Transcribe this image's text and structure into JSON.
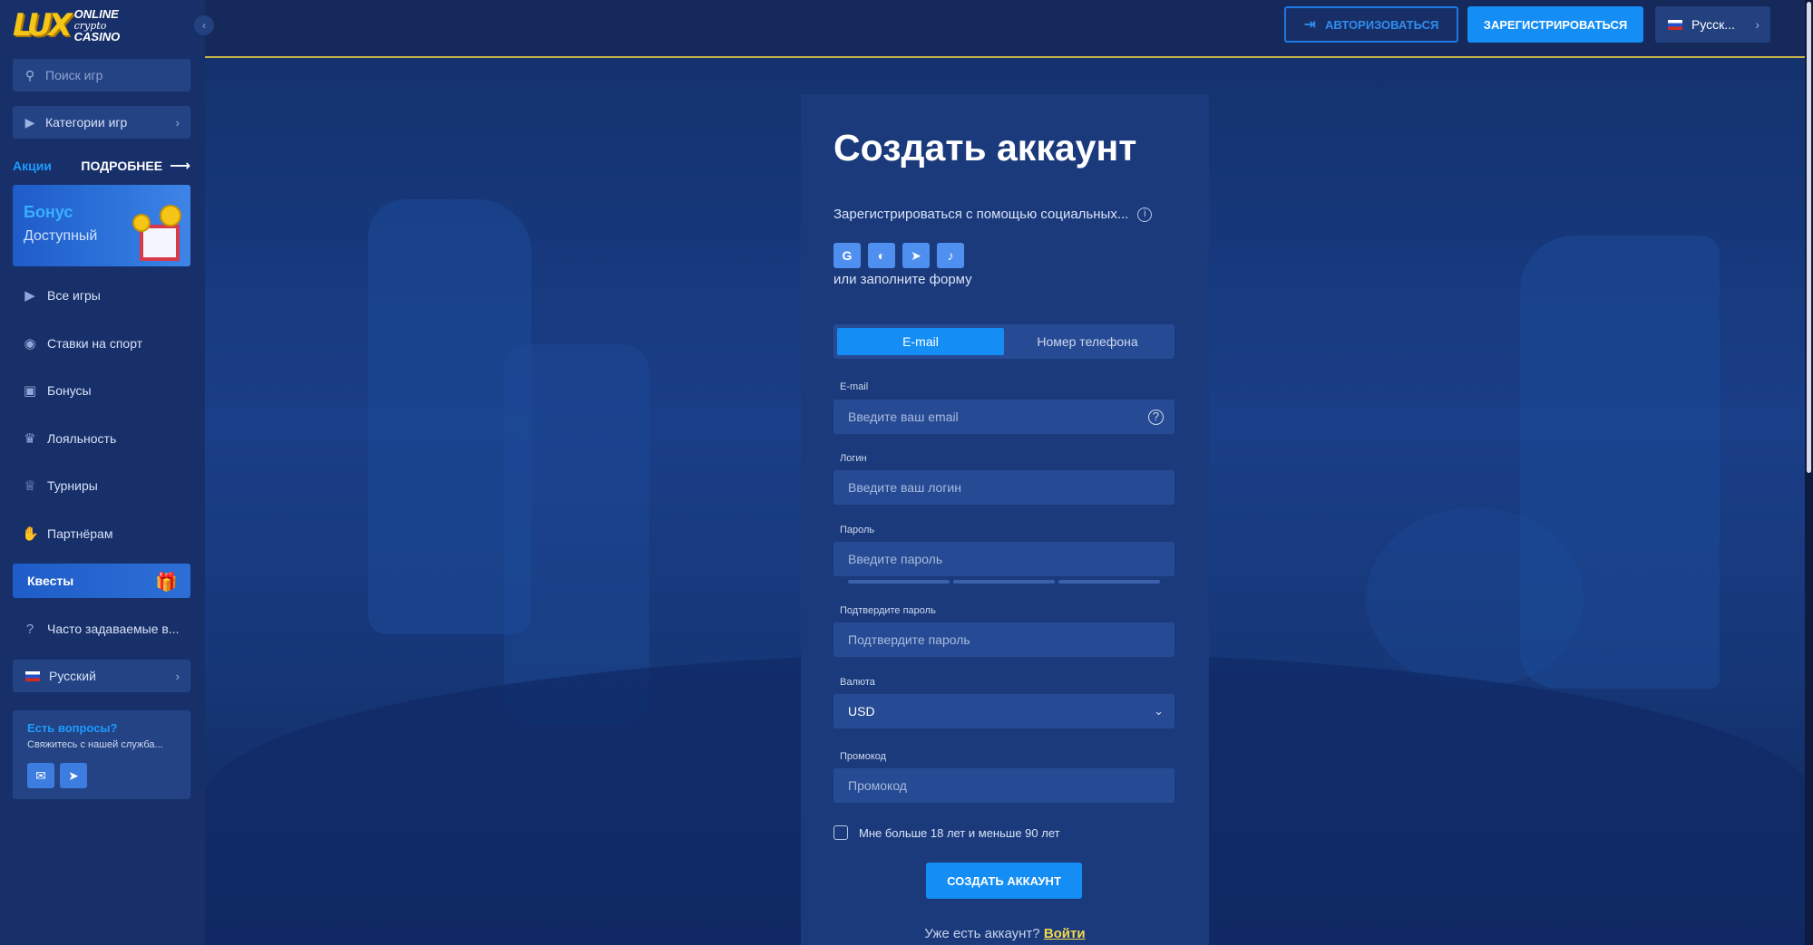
{
  "logo": {
    "mark": "LUX",
    "line1": "ONLINE",
    "line2": "crypto",
    "line3": "CASINO"
  },
  "sidebar": {
    "search_placeholder": "Поиск игр",
    "categories_label": "Категории игр",
    "promo_label": "Акции",
    "more_label": "ПОДРОБНЕЕ",
    "bonus_title": "Бонус",
    "bonus_subtitle": "Доступный",
    "items": [
      {
        "label": "Все игры",
        "icon": "play-icon"
      },
      {
        "label": "Ставки на спорт",
        "icon": "sport-ball-icon"
      },
      {
        "label": "Бонусы",
        "icon": "gift-icon"
      },
      {
        "label": "Лояльность",
        "icon": "loyalty-icon"
      },
      {
        "label": "Турниры",
        "icon": "trophy-icon"
      },
      {
        "label": "Партнёрам",
        "icon": "handshake-icon"
      }
    ],
    "quests_label": "Квесты",
    "faq_label": "Часто задаваемые в...",
    "language_label": "Русский",
    "help_title": "Есть вопросы?",
    "help_text": "Свяжитесь с нашей служба..."
  },
  "topbar": {
    "login_label": "АВТОРИЗОВАТЬСЯ",
    "register_label": "ЗАРЕГИСТРИРОВАТЬСЯ",
    "language_label": "Русск..."
  },
  "form": {
    "title": "Создать аккаунт",
    "social_label": "Зарегистрироваться с помощью социальных...",
    "or_fill": "или заполните форму",
    "tab_email": "E-mail",
    "tab_phone": "Номер телефона",
    "email_label": "E-mail",
    "email_placeholder": "Введите ваш email",
    "login_label": "Логин",
    "login_placeholder": "Введите ваш логин",
    "password_label": "Пароль",
    "password_placeholder": "Введите пароль",
    "confirm_label": "Подтвердите пароль",
    "confirm_placeholder": "Подтвердите пароль",
    "currency_label": "Валюта",
    "currency_value": "USD",
    "promo_label": "Промокод",
    "promo_placeholder": "Промокод",
    "age_text": "Мне больше 18 лет и меньше 90 лет",
    "create_button": "СОЗДАТЬ АККАУНТ",
    "have_account": "Уже есть аккаунт?",
    "signin_link": "Войти"
  },
  "colors": {
    "accent": "#148ef5",
    "panel": "#1b3a7c",
    "link": "#f5d84a"
  }
}
